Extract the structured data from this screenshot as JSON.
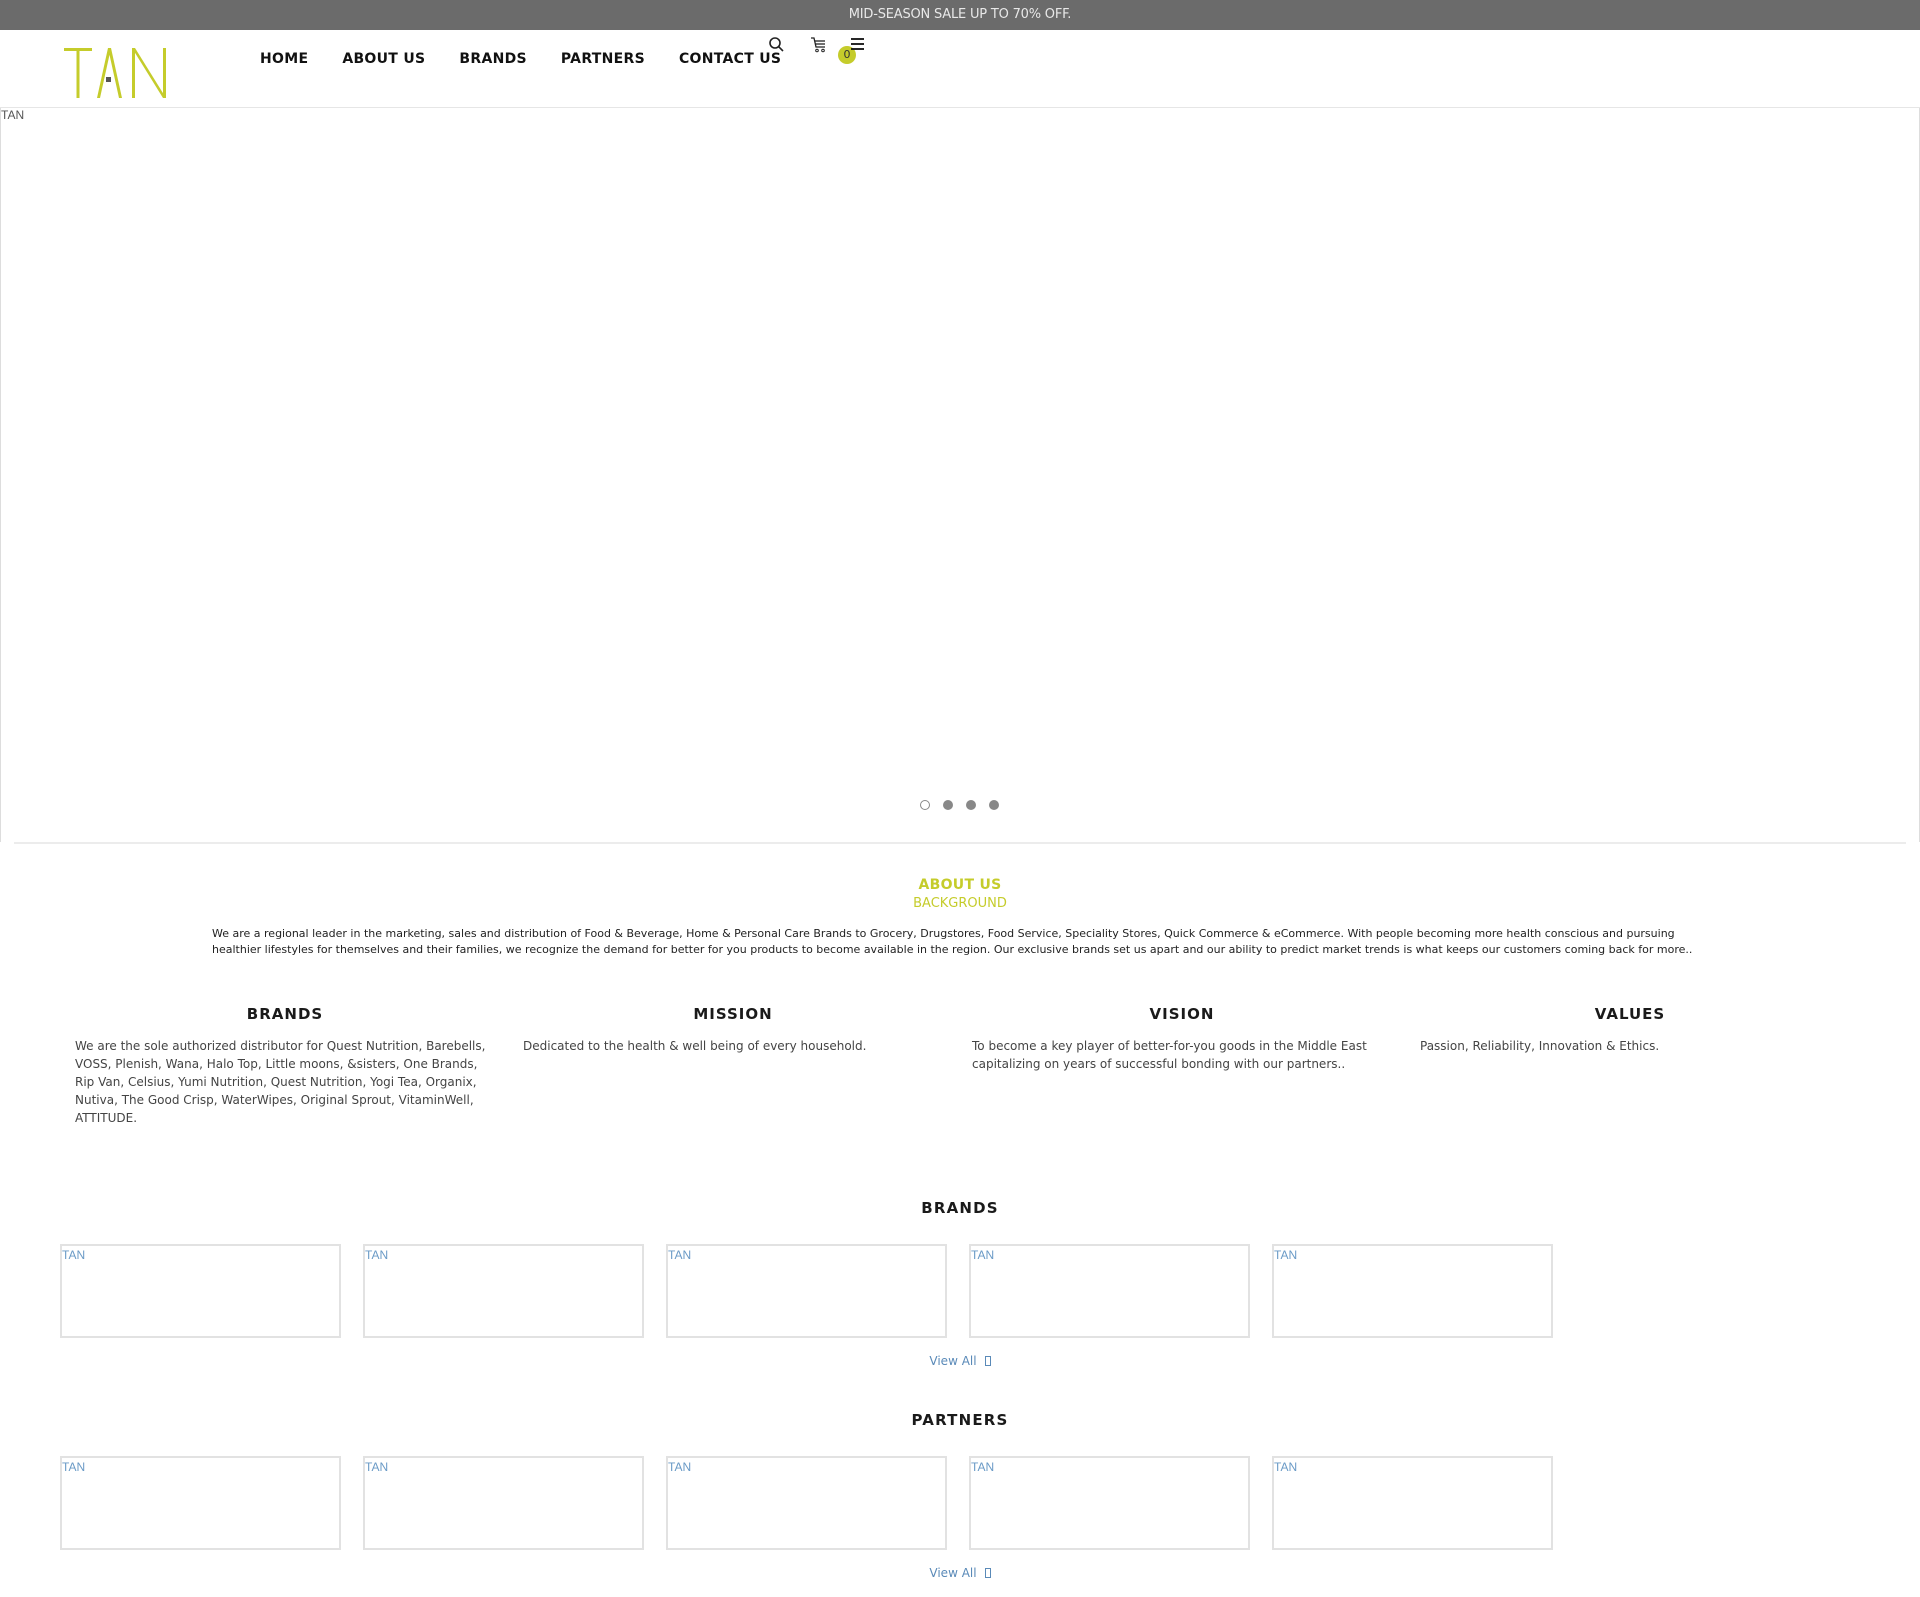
{
  "announcement": "MID-SEASON SALE UP TO 70% OFF.",
  "header": {
    "logo_text": "TAN",
    "nav": [
      {
        "label": "HOME"
      },
      {
        "label": "ABOUT US"
      },
      {
        "label": "BRANDS"
      },
      {
        "label": "PARTNERS"
      },
      {
        "label": "CONTACT US"
      }
    ],
    "icons": {
      "search": "search-icon",
      "cart": "cart-icon",
      "menu": "menu-icon"
    },
    "cart_count": "0"
  },
  "hero": {
    "image_alt": "TAN",
    "slides": 4,
    "active_slide": 1
  },
  "about": {
    "title": "ABOUT US",
    "subtitle": "BACKGROUND",
    "text": "We are a regional leader in the marketing, sales and distribution of Food & Beverage, Home & Personal Care Brands to Grocery, Drugstores, Food Service, Speciality Stores, Quick Commerce & eCommerce. With people becoming more health conscious and pursuing healthier lifestyles for themselves and their families, we recognize the demand for better for you products to become available in the region. Our exclusive brands set us apart and our ability to predict market trends is what keeps our customers coming back for more.."
  },
  "columns": [
    {
      "title": "BRANDS",
      "text": "We are the sole authorized distributor for Quest Nutrition, Barebells, VOSS, Plenish, Wana, Halo Top, Little moons, &sisters, One Brands, Rip Van, Celsius, Yumi Nutrition, Quest Nutrition, Yogi Tea, Organix, Nutiva, The Good Crisp, WaterWipes, Original Sprout, VitaminWell, ATTITUDE."
    },
    {
      "title": "MISSION",
      "text": "Dedicated to the health & well being of every household."
    },
    {
      "title": "VISION",
      "text": "To become a key player of better-for-you goods in the Middle East capitalizing on years of successful bonding with our partners.."
    },
    {
      "title": "VALUES",
      "text": "Passion, Reliability, Innovation & Ethics."
    }
  ],
  "brands": {
    "title": "BRANDS",
    "items": [
      {
        "alt": "TAN"
      },
      {
        "alt": "TAN"
      },
      {
        "alt": "TAN"
      },
      {
        "alt": "TAN"
      },
      {
        "alt": "TAN"
      }
    ],
    "view_all": "View All"
  },
  "partners": {
    "title": "PARTNERS",
    "items": [
      {
        "alt": "TAN"
      },
      {
        "alt": "TAN"
      },
      {
        "alt": "TAN"
      },
      {
        "alt": "TAN"
      },
      {
        "alt": "TAN"
      }
    ],
    "view_all": "View All"
  },
  "colors": {
    "accent": "#c5cc2b",
    "topbar": "#6b6b6b",
    "link": "#5a8ab8"
  }
}
